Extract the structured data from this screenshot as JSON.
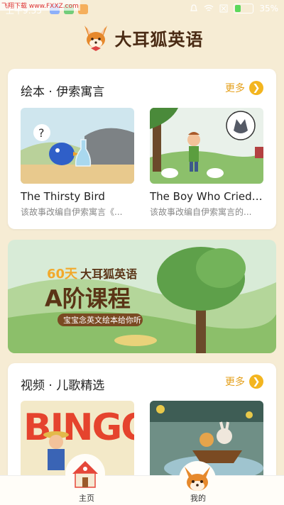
{
  "status": {
    "time": "上午9:35",
    "battery": "35%",
    "battery_level": 0.35,
    "watermark": "飞翔下载 www.FXXZ.com"
  },
  "header": {
    "app_title": "大耳狐英语",
    "logo_icon": "fox-icon"
  },
  "picture_books": {
    "title": "绘本 · 伊索寓言",
    "more_label": "更多",
    "items": [
      {
        "title": "The Thirsty Bird",
        "desc": "该故事改编自伊索寓言《..."
      },
      {
        "title": "The Boy Who Cried ...",
        "desc": "该故事改编自伊索寓言的..."
      }
    ]
  },
  "banner": {
    "line1_prefix": "60天",
    "line1_brand": "大耳狐英语",
    "line2": "A阶课程",
    "line3": "宝宝念英文绘本给你听"
  },
  "videos": {
    "title": "视频 · 儿歌精选",
    "more_label": "更多",
    "items": [
      {
        "thumb_text": "BINGO"
      },
      {
        "thumb_text": ""
      }
    ]
  },
  "tabbar": {
    "tabs": [
      {
        "label": "主页",
        "icon": "house-icon"
      },
      {
        "label": "我的",
        "icon": "fox-icon"
      }
    ]
  },
  "colors": {
    "background": "#f6ecd4",
    "accent": "#f3b51f",
    "title_brown": "#4a2b14"
  }
}
